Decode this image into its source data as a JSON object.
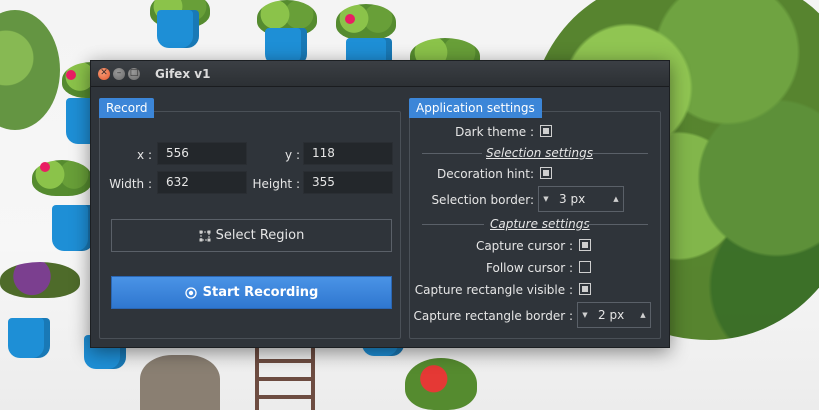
{
  "window": {
    "title": "Gifex v1"
  },
  "record": {
    "tab_label": "Record",
    "x_label": "x :",
    "x_value": "556",
    "y_label": "y :",
    "y_value": "118",
    "width_label": "Width :",
    "width_value": "632",
    "height_label": "Height :",
    "height_value": "355",
    "select_region_label": "Select Region",
    "start_recording_label": "Start Recording"
  },
  "settings": {
    "tab_label": "Application settings",
    "dark_theme": {
      "label": "Dark theme :",
      "checked": true
    },
    "selection_title": "Selection settings",
    "decoration_hint": {
      "label": "Decoration hint:",
      "checked": true
    },
    "selection_border": {
      "label": "Selection border:",
      "value": "3 px"
    },
    "capture_title": "Capture settings",
    "capture_cursor": {
      "label": "Capture cursor :",
      "checked": true
    },
    "follow_cursor": {
      "label": "Follow cursor :",
      "checked": false
    },
    "capture_rect_visible": {
      "label": "Capture rectangle visible :",
      "checked": true
    },
    "capture_rect_border": {
      "label": "Capture rectangle border :",
      "value": "2 px"
    }
  },
  "colors": {
    "accent": "#3c86d8",
    "window_bg": "#2f343a",
    "field_bg": "#23272b"
  }
}
